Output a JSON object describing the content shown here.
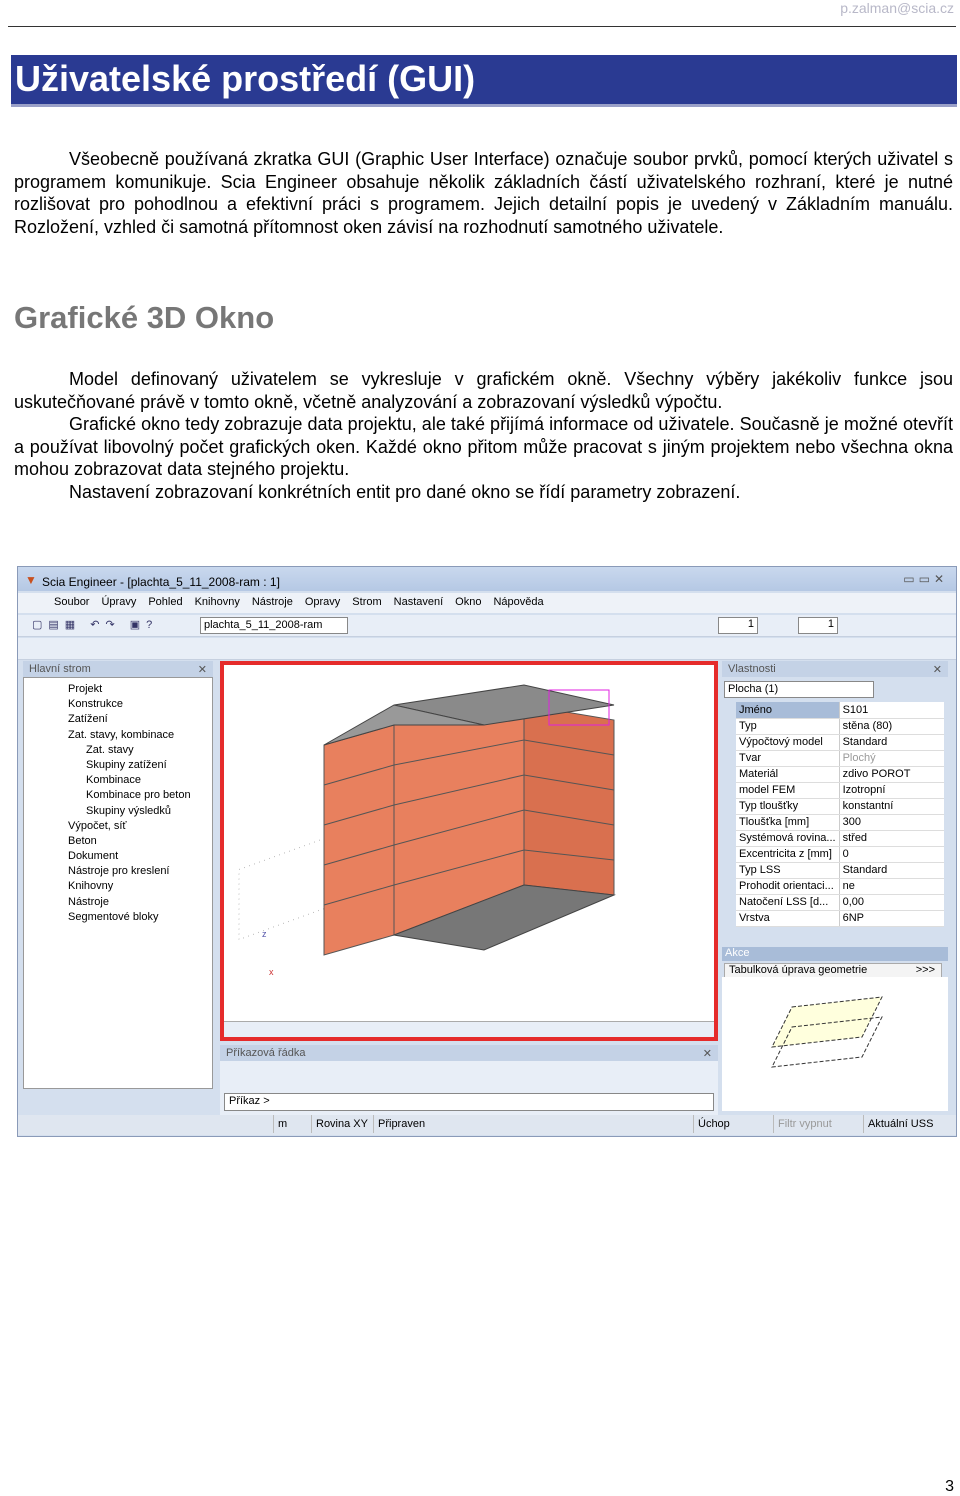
{
  "header": {
    "email": "p.zalman@scia.cz"
  },
  "title": "Uživatelské prostředí (GUI)",
  "intro": "Všeobecně používaná zkratka GUI (Graphic User Interface) označuje soubor prvků, pomocí kterých uživatel s programem komunikuje. Scia Engineer obsahuje několik základních částí uživatelského rozhraní, které je nutné rozlišovat pro pohodlnou a efektivní práci s programem. Jejich detailní popis je uvedený v Základním manuálu. Rozložení, vzhled či samotná přítomnost oken závisí na rozhodnutí samotného uživatele.",
  "section_title": "Grafické 3D Okno",
  "section_paras": [
    "Model definovaný uživatelem se vykresluje v grafickém okně. Všechny výběry jakékoliv funkce jsou uskutečňované právě v tomto okně, včetně analyzování a zobrazovaní výsledků výpočtu.",
    "Grafické okno tedy zobrazuje data projektu, ale také přijímá informace od uživatele. Současně je možné otevřít a používat libovolný počet grafických oken. Každé okno přitom může pracovat s jiným projektem nebo všechna okna mohou zobrazovat data stejného projektu.",
    "Nastavení zobrazovaní konkrétních entit pro dané okno se řídí parametry zobrazení."
  ],
  "screenshot": {
    "window_title": "Scia Engineer - [plachta_5_11_2008-ram : 1]",
    "menu": [
      "Soubor",
      "Úpravy",
      "Pohled",
      "Knihovny",
      "Nástroje",
      "Opravy",
      "Strom",
      "Nastavení",
      "Okno",
      "Nápověda"
    ],
    "project_combo": "plachta_5_11_2008-ram",
    "spin1": "1",
    "spin2": "1",
    "tree_title": "Hlavní strom",
    "tree": [
      "Projekt",
      "Konstrukce",
      "Zatížení",
      "Zat. stavy, kombinace",
      "Zat. stavy",
      "Skupiny zatížení",
      "Kombinace",
      "Kombinace pro beton",
      "Skupiny výsledků",
      "Výpočet, síť",
      "Beton",
      "Dokument",
      "Nástroje pro kreslení",
      "Knihovny",
      "Nástroje",
      "Segmentové bloky"
    ],
    "props_title": "Vlastnosti",
    "props_combo": "Plocha (1)",
    "props": [
      [
        "Jméno",
        "S101"
      ],
      [
        "Typ",
        "stěna (80)"
      ],
      [
        "Výpočtový model",
        "Standard"
      ],
      [
        "Tvar",
        "Plochý"
      ],
      [
        "Materiál",
        "zdivo POROT"
      ],
      [
        "model FEM",
        "Izotropní"
      ],
      [
        "Typ tloušťky",
        "konstantní"
      ],
      [
        "Tloušťka [mm]",
        "300"
      ],
      [
        "Systémová rovina...",
        "střed"
      ],
      [
        "Excentricita z [mm]",
        "0"
      ],
      [
        "Typ LSS",
        "Standard"
      ],
      [
        "Prohodit orientaci...",
        "ne"
      ],
      [
        "Natočení LSS [d...",
        "0,00"
      ],
      [
        "Vrstva",
        "6NP"
      ]
    ],
    "actions_title": "Akce",
    "action": "Tabulková úprava geometrie",
    "action_btn": ">>>",
    "cmd_title": "Příkazová řádka",
    "cmd_prompt": "Příkaz >",
    "status": [
      "m",
      "Rovina XY",
      "Připraven",
      "Úchop",
      "Filtr vypnut",
      "Aktuální USS"
    ],
    "colors": {
      "wall": "#e8805e",
      "floor": "#8a8a8a",
      "selection": "#e52b2b"
    }
  },
  "page_number": "3"
}
